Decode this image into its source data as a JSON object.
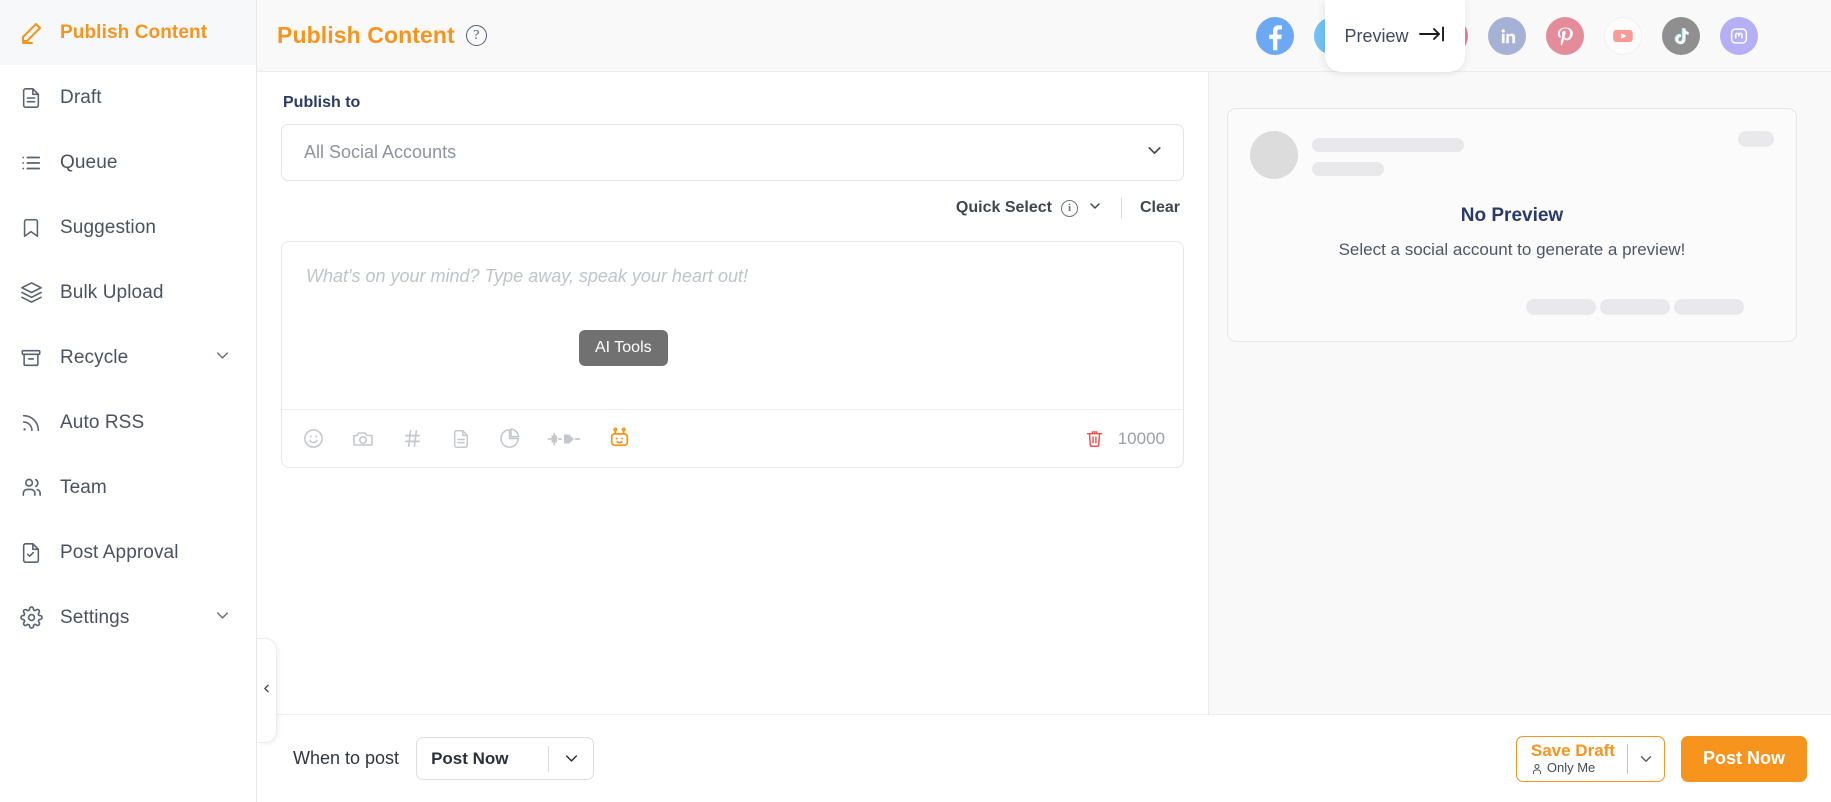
{
  "sidebar": {
    "items": [
      {
        "label": "Publish Content",
        "icon": "pencil-icon",
        "active": true,
        "chevron": false
      },
      {
        "label": "Draft",
        "icon": "document-icon",
        "active": false,
        "chevron": false
      },
      {
        "label": "Queue",
        "icon": "list-icon",
        "active": false,
        "chevron": false
      },
      {
        "label": "Suggestion",
        "icon": "bookmark-icon",
        "active": false,
        "chevron": false
      },
      {
        "label": "Bulk Upload",
        "icon": "layers-icon",
        "active": false,
        "chevron": false
      },
      {
        "label": "Recycle",
        "icon": "archive-icon",
        "active": false,
        "chevron": true
      },
      {
        "label": "Auto RSS",
        "icon": "rss-icon",
        "active": false,
        "chevron": false
      },
      {
        "label": "Team",
        "icon": "users-icon",
        "active": false,
        "chevron": false
      },
      {
        "label": "Post Approval",
        "icon": "document-check-icon",
        "active": false,
        "chevron": false
      },
      {
        "label": "Settings",
        "icon": "gear-icon",
        "active": false,
        "chevron": true
      }
    ],
    "collapse_icon": "chevron-left-icon"
  },
  "header": {
    "title": "Publish Content",
    "help_icon": "question-mark-icon",
    "preview_label": "Preview",
    "preview_icon": "arrow-to-right-bar-icon",
    "social_accounts": [
      {
        "name": "facebook-icon",
        "color": "#1877f2"
      },
      {
        "name": "twitter-icon",
        "color": "#1da1f2"
      },
      {
        "name": "google-business-icon",
        "color": "#7986cb"
      },
      {
        "name": "instagram-icon",
        "color": "#e1306c"
      },
      {
        "name": "linkedin-icon",
        "color": "#0a66c2"
      },
      {
        "name": "pinterest-icon",
        "color": "#e60023"
      },
      {
        "name": "youtube-icon",
        "color": "#ff0000"
      },
      {
        "name": "tiktok-icon",
        "color": "#010101"
      },
      {
        "name": "mastodon-icon",
        "color": "#6364ff"
      }
    ]
  },
  "composer": {
    "publish_to_label": "Publish to",
    "account_select_value": "All Social Accounts",
    "account_select_chevron": "chevron-down-icon",
    "quick_select_label": "Quick Select",
    "quick_select_info_icon": "info-icon",
    "quick_select_chevron": "chevron-down-icon",
    "clear_label": "Clear",
    "editor_placeholder": "What's on your mind? Type away, speak your heart out!",
    "ai_tooltip": "AI Tools",
    "toolbar_icons": [
      "emoji-icon",
      "camera-icon",
      "hashtag-icon",
      "document-icon",
      "pie-chart-icon",
      "plug-icon",
      "robot-icon"
    ],
    "delete_icon": "trash-icon",
    "char_count": "10000"
  },
  "preview": {
    "no_preview_title": "No Preview",
    "no_preview_subtitle": "Select a social account to generate a preview!"
  },
  "footer": {
    "when_to_post_label": "When to post",
    "when_to_post_value": "Post Now",
    "when_to_post_chevron": "chevron-down-icon",
    "save_draft_label": "Save Draft",
    "save_draft_visibility": "Only Me",
    "save_draft_visibility_icon": "person-icon",
    "save_draft_chevron": "chevron-down-icon",
    "post_now_label": "Post Now"
  },
  "colors": {
    "accent": "#f7941e",
    "navy": "#2b3a67",
    "muted": "#8d939e",
    "delete": "#f0514f"
  }
}
